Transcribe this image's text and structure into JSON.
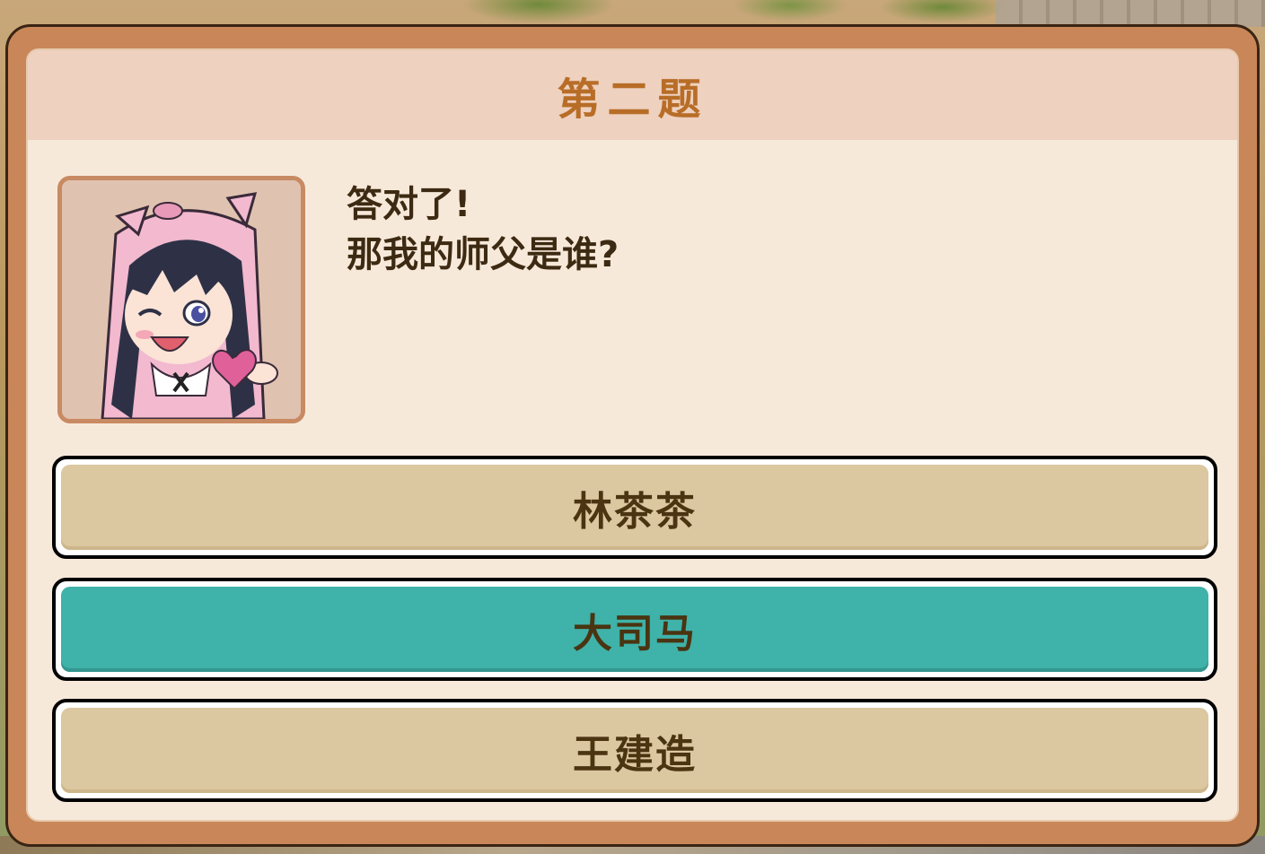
{
  "quiz": {
    "title": "第二题",
    "dialog_lines": [
      "答对了!",
      "那我的师父是谁?"
    ],
    "options": [
      {
        "label": "林茶茶",
        "state": "normal"
      },
      {
        "label": "大司马",
        "state": "selected"
      },
      {
        "label": "王建造",
        "state": "normal"
      }
    ]
  },
  "colors": {
    "frame": "#c98759",
    "panel": "#f7e9da",
    "title_bar": "#eed1bf",
    "title_text": "#b86d27",
    "option_normal": "#dbc7a0",
    "option_selected": "#3fb2a9",
    "option_text": "#4a3411"
  },
  "icons": {
    "portrait": "pig-hood-girl-portrait",
    "heart": "heart-icon"
  }
}
